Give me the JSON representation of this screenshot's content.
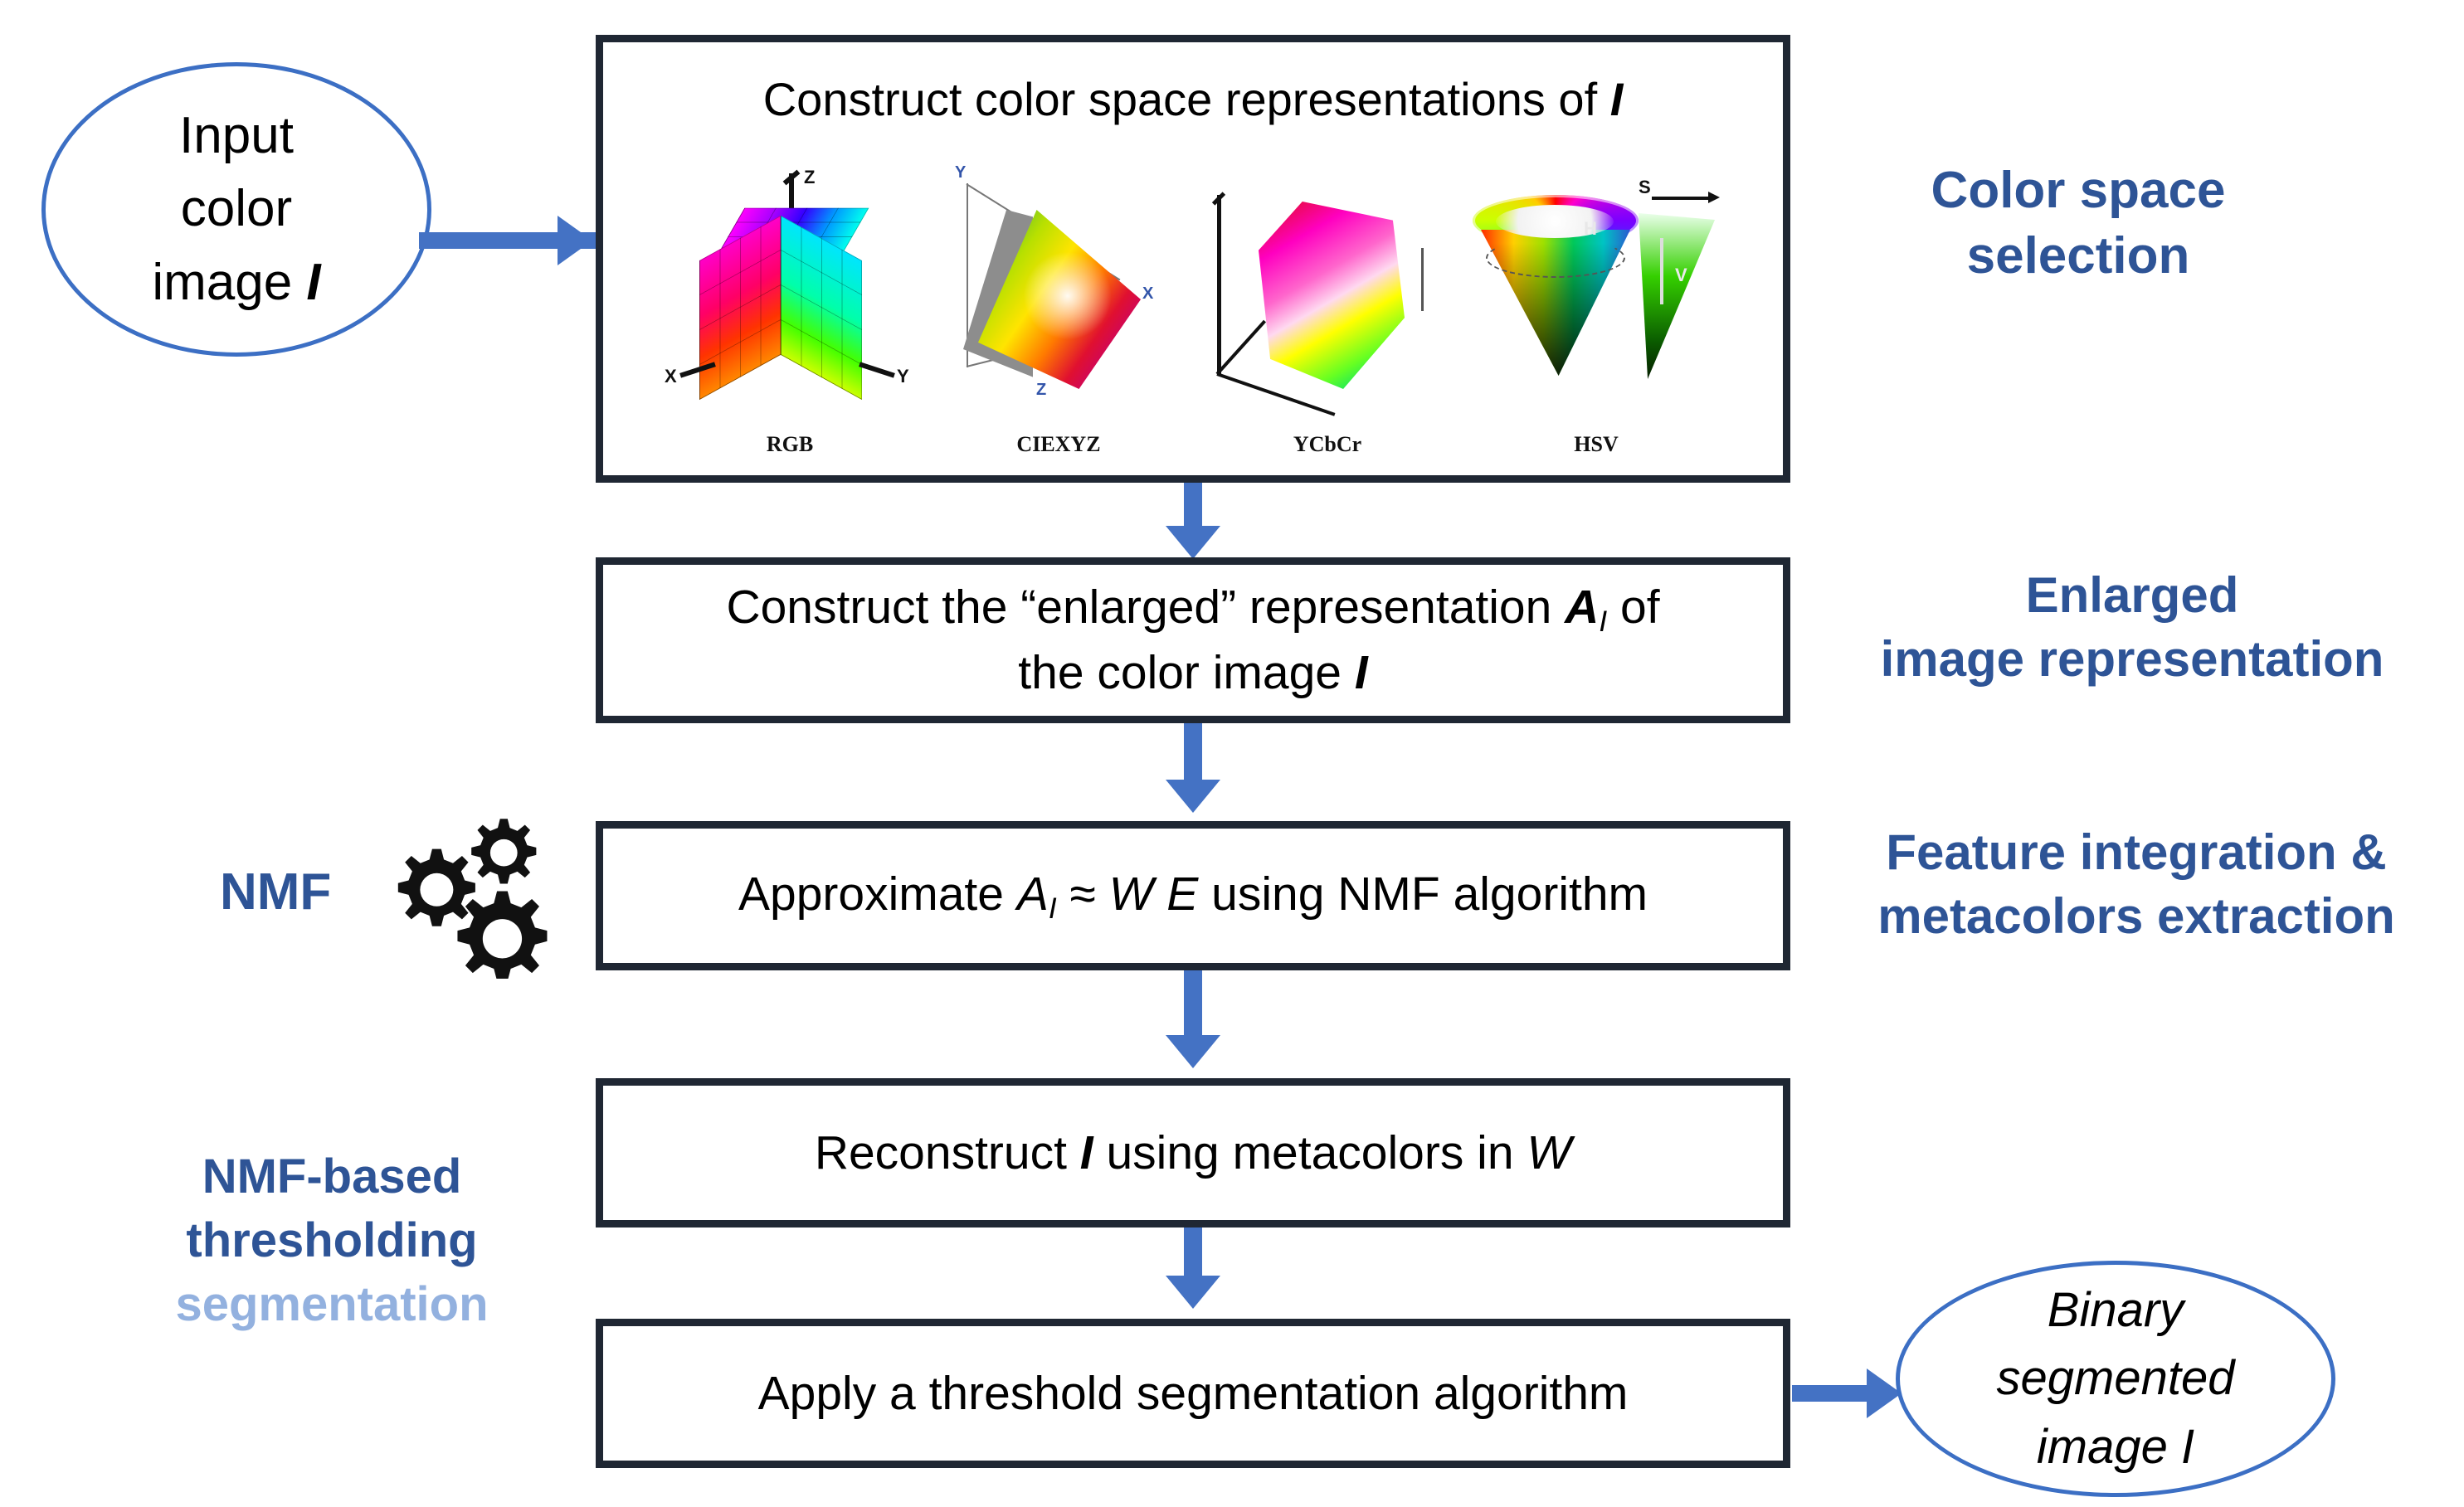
{
  "flow": {
    "input_node": {
      "line1": "Input",
      "line2": "color",
      "line3_prefix": "image ",
      "line3_symbol": "I"
    },
    "output_node": {
      "line1": "Binary",
      "line2": "segmented",
      "line3": "image I"
    },
    "boxes": {
      "colorspace": {
        "title_prefix": "Construct color space representations of ",
        "title_symbol": "I",
        "colorspaces": [
          {
            "caption": "RGB",
            "axes": [
              "X",
              "Y",
              "Z"
            ]
          },
          {
            "caption": "CIEXYZ",
            "axes": [
              "Y",
              "X",
              "Z"
            ]
          },
          {
            "caption": "YCbCr",
            "axes": []
          },
          {
            "caption": "HSV",
            "axes": [
              "H",
              "S",
              "V"
            ]
          }
        ]
      },
      "enlarged": {
        "line1_a": "Construct the “enlarged” representation ",
        "line1_sym": "A",
        "line1_sub": "I",
        "line1_b": " of",
        "line2_a": "the color image ",
        "line2_sym": "I"
      },
      "nmf": {
        "a": "Approximate ",
        "sym1": "A",
        "sub1": "I",
        "b": " ≈ ",
        "sym2": "W",
        "c": " ",
        "sym3": "E",
        "d": " using NMF algorithm"
      },
      "reconstruct": {
        "a": "Reconstruct ",
        "sym1": "I",
        "b": " using metacolors in ",
        "sym2": "W"
      },
      "threshold": {
        "text": "Apply a threshold segmentation algorithm"
      }
    }
  },
  "stage_labels": {
    "colorspace": {
      "line1": "Color space",
      "line2": "selection"
    },
    "enlarged": {
      "line1": "Enlarged",
      "line2": "image representation"
    },
    "feature": {
      "line1": "Feature integration &",
      "line2": "metacolors extraction"
    }
  },
  "side_labels": {
    "nmf": "NMF",
    "thresholding": {
      "line1": "NMF-based",
      "line2": "thresholding",
      "line3": "segmentation"
    }
  },
  "colors": {
    "arrow_blue": "#4472C4",
    "ellipse_blue": "#3C6FC4",
    "box_border": "#1F2733",
    "label_blue": "#2E5496",
    "label_blue_faded": "#93B1DF"
  }
}
